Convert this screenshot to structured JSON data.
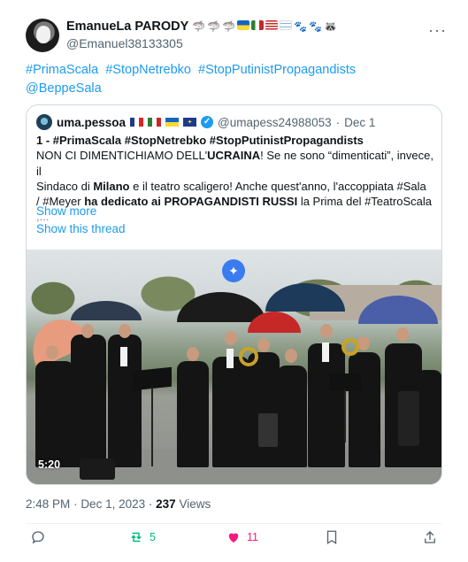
{
  "author": {
    "name": "EmanueLa PARODY",
    "handle": "@Emanuel38133305",
    "emoji_row": [
      "shark",
      "shark",
      "shark",
      "ukraine-flag",
      "italy-flag",
      "usa-flag",
      "israel-flag",
      "paw",
      "paw",
      "raccoon"
    ]
  },
  "tweet": {
    "hashtags": [
      "#PrimaScala",
      "#StopNetrebko",
      "#StopPutinistPropagandists",
      "@BeppeSala"
    ]
  },
  "quote": {
    "name": "uma.pessoa",
    "handle": "@umapess24988053",
    "sep": "·",
    "date": "Dec 1",
    "lines": [
      "1 - #PrimaScala #StopNetrebko #StopPutinistPropagandists",
      "NON CI DIMENTICHIAMO DELL'",
      "UCRAINA",
      "! Se ne sono “dimenticati”, invece, il",
      "Sindaco di ",
      "Milano",
      " e il teatro scaligero! Anche quest'anno, l'accoppiata  #Sala",
      "/ #Meyer ",
      "ha dedicato ai PROPAGANDISTI RUSSI",
      " la Prima del #TeatroScala",
      ",..."
    ],
    "show_more": "Show more",
    "show_thread": "Show this thread",
    "video_time": "5:20"
  },
  "meta": {
    "time": "2:48 PM",
    "sep": "·",
    "date": "Dec 1, 2023",
    "views_count": "237",
    "views_label": "Views"
  },
  "actions": {
    "retweets": "5",
    "likes": "11"
  },
  "colors": {
    "accent": "#1d9bf0",
    "retweet": "#00ba7c",
    "like": "#f91880",
    "muted": "#536471"
  }
}
